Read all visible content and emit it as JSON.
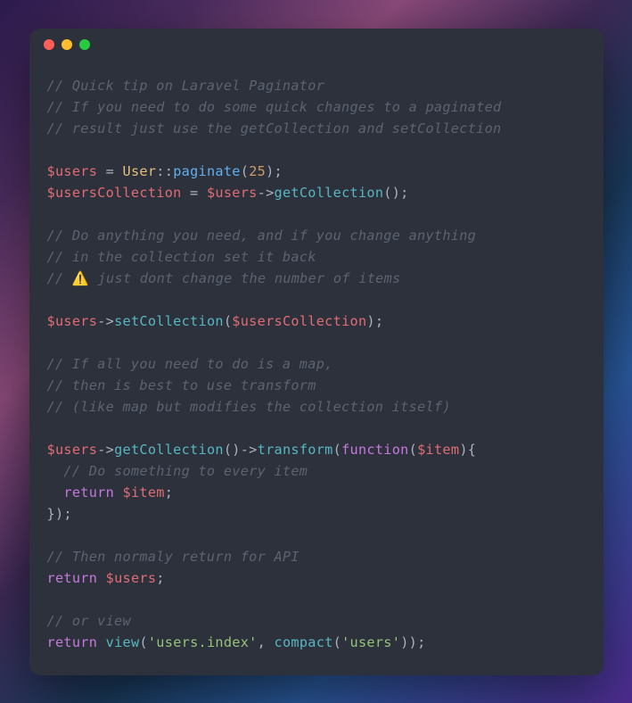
{
  "lines": [
    [
      {
        "cls": "c-comment",
        "text": "// Quick tip on Laravel Paginator"
      }
    ],
    [
      {
        "cls": "c-comment",
        "text": "// If you need to do some quick changes to a paginated"
      }
    ],
    [
      {
        "cls": "c-comment",
        "text": "// result just use the getCollection and setCollection"
      }
    ],
    [],
    [
      {
        "cls": "c-variable",
        "text": "$users"
      },
      {
        "cls": "c-punct",
        "text": " = "
      },
      {
        "cls": "c-class",
        "text": "User"
      },
      {
        "cls": "c-punct",
        "text": "::"
      },
      {
        "cls": "c-method",
        "text": "paginate"
      },
      {
        "cls": "c-punct",
        "text": "("
      },
      {
        "cls": "c-number",
        "text": "25"
      },
      {
        "cls": "c-punct",
        "text": ");"
      }
    ],
    [
      {
        "cls": "c-variable",
        "text": "$usersCollection"
      },
      {
        "cls": "c-punct",
        "text": " = "
      },
      {
        "cls": "c-variable",
        "text": "$users"
      },
      {
        "cls": "c-punct",
        "text": "->"
      },
      {
        "cls": "c-call",
        "text": "getCollection"
      },
      {
        "cls": "c-punct",
        "text": "();"
      }
    ],
    [],
    [
      {
        "cls": "c-comment",
        "text": "// Do anything you need, and if you change anything"
      }
    ],
    [
      {
        "cls": "c-comment",
        "text": "// in the collection set it back"
      }
    ],
    [
      {
        "cls": "c-comment",
        "text": "// "
      },
      {
        "cls": "c-emoji",
        "text": "⚠️"
      },
      {
        "cls": "c-comment",
        "text": " just dont change the number of items"
      }
    ],
    [],
    [
      {
        "cls": "c-variable",
        "text": "$users"
      },
      {
        "cls": "c-punct",
        "text": "->"
      },
      {
        "cls": "c-call",
        "text": "setCollection"
      },
      {
        "cls": "c-punct",
        "text": "("
      },
      {
        "cls": "c-variable",
        "text": "$usersCollection"
      },
      {
        "cls": "c-punct",
        "text": ");"
      }
    ],
    [],
    [
      {
        "cls": "c-comment",
        "text": "// If all you need to do is a map,"
      }
    ],
    [
      {
        "cls": "c-comment",
        "text": "// then is best to use transform"
      }
    ],
    [
      {
        "cls": "c-comment",
        "text": "// (like map but modifies the collection itself)"
      }
    ],
    [],
    [
      {
        "cls": "c-variable",
        "text": "$users"
      },
      {
        "cls": "c-punct",
        "text": "->"
      },
      {
        "cls": "c-call",
        "text": "getCollection"
      },
      {
        "cls": "c-punct",
        "text": "()->"
      },
      {
        "cls": "c-call",
        "text": "transform"
      },
      {
        "cls": "c-punct",
        "text": "("
      },
      {
        "cls": "c-function",
        "text": "function"
      },
      {
        "cls": "c-punct",
        "text": "("
      },
      {
        "cls": "c-variable",
        "text": "$item"
      },
      {
        "cls": "c-punct",
        "text": "){"
      }
    ],
    [
      {
        "cls": "c-comment",
        "text": "  // Do something to every item"
      }
    ],
    [
      {
        "cls": "c-punct",
        "text": "  "
      },
      {
        "cls": "c-return",
        "text": "return"
      },
      {
        "cls": "c-punct",
        "text": " "
      },
      {
        "cls": "c-variable",
        "text": "$item"
      },
      {
        "cls": "c-punct",
        "text": ";"
      }
    ],
    [
      {
        "cls": "c-punct",
        "text": "});"
      }
    ],
    [],
    [
      {
        "cls": "c-comment",
        "text": "// Then normaly return for API"
      }
    ],
    [
      {
        "cls": "c-return",
        "text": "return"
      },
      {
        "cls": "c-punct",
        "text": " "
      },
      {
        "cls": "c-variable",
        "text": "$users"
      },
      {
        "cls": "c-punct",
        "text": ";"
      }
    ],
    [],
    [
      {
        "cls": "c-comment",
        "text": "// or view"
      }
    ],
    [
      {
        "cls": "c-return",
        "text": "return"
      },
      {
        "cls": "c-punct",
        "text": " "
      },
      {
        "cls": "c-call",
        "text": "view"
      },
      {
        "cls": "c-punct",
        "text": "("
      },
      {
        "cls": "c-string",
        "text": "'users.index'"
      },
      {
        "cls": "c-punct",
        "text": ", "
      },
      {
        "cls": "c-call",
        "text": "compact"
      },
      {
        "cls": "c-punct",
        "text": "("
      },
      {
        "cls": "c-string",
        "text": "'users'"
      },
      {
        "cls": "c-punct",
        "text": "));"
      }
    ]
  ]
}
